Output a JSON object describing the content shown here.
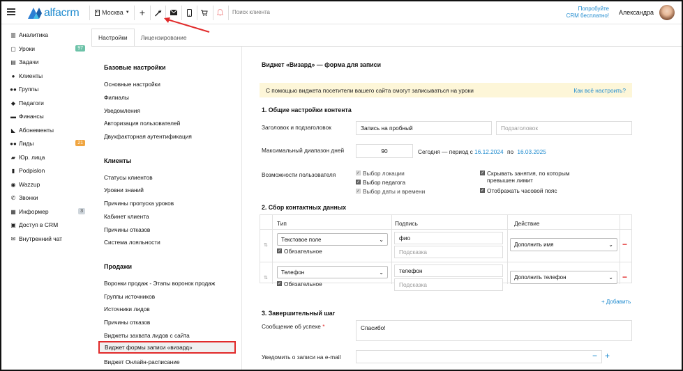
{
  "header": {
    "logo_text": "alfacrm",
    "city": "Москва",
    "search_placeholder": "Поиск клиента",
    "promo_line1": "Попробуйте",
    "promo_line2": "CRM бесплатно!",
    "user_name": "Александра"
  },
  "sidebar": {
    "items": [
      {
        "label": "Аналитика",
        "icon": "chart-icon"
      },
      {
        "label": "Уроки",
        "icon": "calendar-icon",
        "badge": "97"
      },
      {
        "label": "Задачи",
        "icon": "tasks-icon"
      },
      {
        "label": "Клиенты",
        "icon": "user-icon"
      },
      {
        "label": "Группы",
        "icon": "users-icon"
      },
      {
        "label": "Педагоги",
        "icon": "graduation-cap-icon"
      },
      {
        "label": "Финансы",
        "icon": "money-icon"
      },
      {
        "label": "Абонементы",
        "icon": "tag-icon"
      },
      {
        "label": "Лиды",
        "icon": "users-icon",
        "badge": "21"
      },
      {
        "label": "Юр. лица",
        "icon": "truck-icon"
      },
      {
        "label": "Podpislon",
        "icon": "document-icon"
      },
      {
        "label": "Wazzup",
        "icon": "chat-bubble-icon"
      },
      {
        "label": "Звонки",
        "icon": "phone-icon"
      },
      {
        "label": "Информер",
        "icon": "informer-icon",
        "badge": "3"
      },
      {
        "label": "Доступ в CRM",
        "icon": "lock-icon"
      },
      {
        "label": "Внутренний чат",
        "icon": "envelope-icon"
      }
    ]
  },
  "tabs": [
    {
      "label": "Настройки",
      "active": true
    },
    {
      "label": "Лицензирование",
      "active": false
    }
  ],
  "settings": {
    "sections": [
      {
        "title": "Базовые настройки",
        "items": [
          "Основные настройки",
          "Филиалы",
          "Уведомления",
          "Авторизация пользователей",
          "Двухфакторная аутентификация"
        ]
      },
      {
        "title": "Клиенты",
        "items": [
          "Статусы клиентов",
          "Уровни знаний",
          "Причины пропуска уроков",
          "Кабинет клиента",
          "Причины отказов",
          "Система лояльности"
        ]
      },
      {
        "title": "Продажи",
        "items": [
          "Воронки продаж - Этапы воронок продаж",
          "Группы источников",
          "Источники лидов",
          "Причины отказов",
          "Виджеты захвата лидов с сайта",
          "Виджет формы записи «визард»",
          "Виджет Онлайн-расписание"
        ]
      }
    ]
  },
  "content": {
    "title": "Виджет «Визард» — форма для записи",
    "info_text": "С помощью виджета посетители вашего сайта смогут записываться на уроки",
    "info_link": "Как всё настроить?",
    "s1_title": "1. Общие настройки контента",
    "heading_label": "Заголовок и подзаголовок",
    "heading_value": "Запись на пробный",
    "subheading_placeholder": "Подзаголовок",
    "range_label": "Максимальный диапазон дней",
    "range_value": "90",
    "period_text": "Сегодня — период с",
    "period_from": "16.12.2024",
    "period_to_word": "по",
    "period_to": "16.03.2025",
    "abilities_label": "Возможности пользователя",
    "abilities": [
      {
        "label": "Выбор локации",
        "checked": true,
        "disabled": true
      },
      {
        "label": "Выбор педагога",
        "checked": true,
        "disabled": false
      },
      {
        "label": "Выбор даты и времени",
        "checked": true,
        "disabled": true
      }
    ],
    "abilities_right": [
      {
        "label_line1": "Скрывать занятия, по которым",
        "label_line2": "превышен лимит",
        "checked": true
      },
      {
        "label": "Отображать часовой пояс",
        "checked": true
      }
    ],
    "s2_title": "2. Сбор контактных данных",
    "table": {
      "headers": [
        "Тип",
        "Подпись",
        "Действие"
      ],
      "rows": [
        {
          "type": "Текстовое поле",
          "required": "Обязательное",
          "caption": "фио",
          "hint_placeholder": "Подсказка",
          "action": "Дополнить имя"
        },
        {
          "type": "Телефон",
          "required": "Обязательное",
          "caption": "телефон",
          "hint_placeholder": "Подсказка",
          "action": "Дополнить телефон"
        }
      ],
      "add_link": "Добавить"
    },
    "s3_title": "3. Завершительный шаг",
    "success_label": "Сообщение об успехе",
    "success_required_mark": "*",
    "success_value": "Спасибо!",
    "notify_label": "Уведомить о записи на e-mail"
  },
  "colors": {
    "accent": "#1f8bcf",
    "highlight": "#e12a2a",
    "info_bg": "#fdf6d8"
  }
}
